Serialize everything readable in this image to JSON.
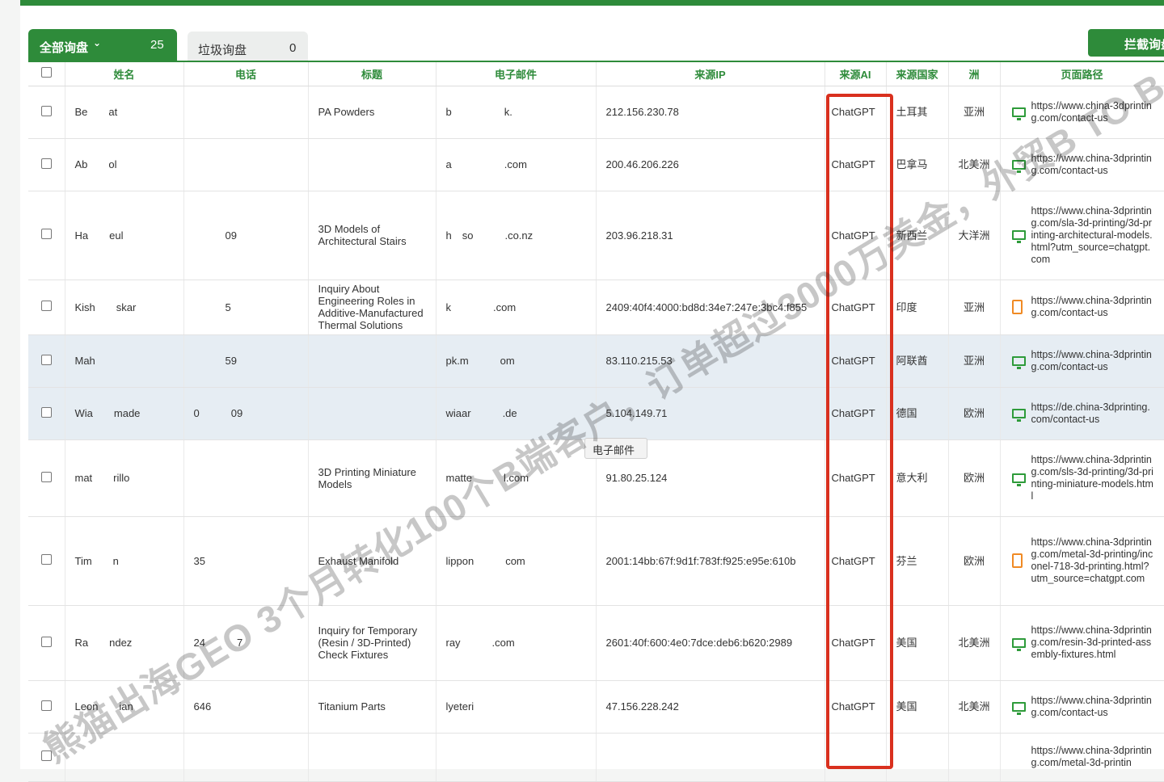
{
  "tabs": {
    "all_label": "全部询盘",
    "all_count": "25",
    "spam_label": "垃圾询盘",
    "spam_count": "0"
  },
  "block_button": "拦截询盘",
  "tooltip": "电子邮件",
  "watermark": "熊猫出海GEO 3个月转化100个B端客户，订单超过3000万美金，外贸B TO B",
  "columns": [
    "姓名",
    "电话",
    "标题",
    "电子邮件",
    "来源IP",
    "来源AI",
    "来源国家",
    "洲",
    "页面路径"
  ],
  "rows": [
    {
      "name": "Be  at",
      "phone": "",
      "title": "PA Powders",
      "email": "b     k.",
      "ip": "212.156.230.78",
      "ai": "ChatGPT",
      "country": "土耳其",
      "continent": "亚洲",
      "path": "https://www.china-3dprinting.com/contact-us",
      "device": "desktop"
    },
    {
      "name": "Ab  ol",
      "phone": "",
      "title": "",
      "email": "a     .com",
      "ip": "200.46.206.226",
      "ai": "ChatGPT",
      "country": "巴拿马",
      "continent": "北美洲",
      "path": "https://www.china-3dprinting.com/contact-us",
      "device": "desktop"
    },
    {
      "name": "Ha  eul",
      "phone": "   09",
      "title": "3D Models of Architectural Stairs",
      "email": "h so   .co.nz",
      "ip": "203.96.218.31",
      "ai": "ChatGPT",
      "country": "新西兰",
      "continent": "大洋洲",
      "path": "https://www.china-3dprinting.com/sla-3d-printing/3d-printing-architectural-models.html?utm_source=chatgpt.com",
      "device": "desktop"
    },
    {
      "name": "Kish  skar",
      "phone": "   5",
      "title": "Inquiry About Engineering Roles in Additive-Manufactured Thermal Solutions",
      "email": "k    .com",
      "ip": "2409:40f4:4000:bd8d:34e7:247e:3bc4:f855",
      "ai": "ChatGPT",
      "country": "印度",
      "continent": "亚洲",
      "path": "https://www.china-3dprinting.com/contact-us",
      "device": "tablet"
    },
    {
      "name": "Mah",
      "phone": "   59",
      "title": "",
      "email": "pk.m   om",
      "ip": "83.110.215.53",
      "ai": "ChatGPT",
      "country": "阿联酋",
      "continent": "亚洲",
      "path": "https://www.china-3dprinting.com/contact-us",
      "device": "desktop"
    },
    {
      "name": "Wia  made",
      "phone": "0   09",
      "title": "",
      "email": "wiaar   .de",
      "ip": "5.104.149.71",
      "ai": "ChatGPT",
      "country": "德国",
      "continent": "欧洲",
      "path": "https://de.china-3dprinting.com/contact-us",
      "device": "desktop"
    },
    {
      "name": "mat  rillo",
      "phone": "",
      "title": "3D Printing Miniature Models",
      "email": "matte   l.com",
      "ip": "91.80.25.124",
      "ai": "ChatGPT",
      "country": "意大利",
      "continent": "欧洲",
      "path": "https://www.china-3dprinting.com/sls-3d-printing/3d-printing-miniature-models.html",
      "device": "desktop"
    },
    {
      "name": "Tim  n",
      "phone": "35",
      "title": "Exhaust Manifold",
      "email": "lippon   com",
      "ip": "2001:14bb:67f:9d1f:783f:f925:e95e:610b",
      "ai": "ChatGPT",
      "country": "芬兰",
      "continent": "欧洲",
      "path": "https://www.china-3dprinting.com/metal-3d-printing/inconel-718-3d-printing.html?utm_source=chatgpt.com",
      "device": "tablet"
    },
    {
      "name": "Ra  ndez",
      "phone": "24   7",
      "title": "Inquiry for Temporary (Resin / 3D-Printed) Check Fixtures",
      "email": "ray   .com",
      "ip": "2601:40f:600:4e0:7dce:deb6:b620:2989",
      "ai": "ChatGPT",
      "country": "美国",
      "continent": "北美洲",
      "path": "https://www.china-3dprinting.com/resin-3d-printed-assembly-fixtures.html",
      "device": "desktop"
    },
    {
      "name": "Leon  ian",
      "phone": "646",
      "title": "Titanium Parts",
      "email": "lyeteri   ",
      "ip": "47.156.228.242",
      "ai": "ChatGPT",
      "country": "美国",
      "continent": "北美洲",
      "path": "https://www.china-3dprinting.com/contact-us",
      "device": "desktop"
    },
    {
      "name": "",
      "phone": "",
      "title": "",
      "email": "",
      "ip": "",
      "ai": "",
      "country": "",
      "continent": "",
      "path": "https://www.china-3dprinting.com/metal-3d-printin",
      "device": "none"
    }
  ]
}
